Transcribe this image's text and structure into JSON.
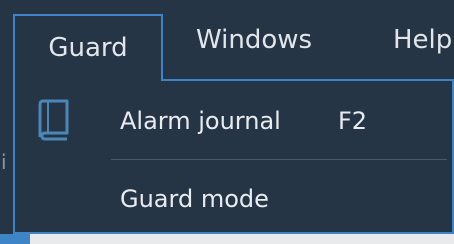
{
  "menubar": {
    "items": [
      {
        "label": "Guard"
      },
      {
        "label": "Windows"
      },
      {
        "label": "Help"
      }
    ]
  },
  "dropdown": {
    "items": [
      {
        "label": "Alarm journal",
        "shortcut": "F2",
        "icon": "book-icon"
      },
      {
        "label": "Guard mode"
      }
    ]
  },
  "colors": {
    "background": "#263545",
    "accent": "#3e85c8",
    "text": "#e2e6eb",
    "icon": "#4a86b8"
  }
}
